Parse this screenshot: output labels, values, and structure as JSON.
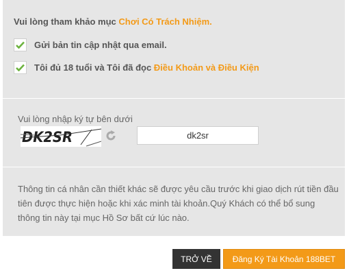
{
  "consent": {
    "intro_prefix": "Vui lòng tham khảo mục ",
    "intro_link": "Chơi Có Trách Nhiệm.",
    "newsletter_label": "Gửi bản tin cập nhật qua email.",
    "age_label_prefix": "Tôi đủ 18 tuổi và Tôi đã đọc ",
    "age_label_link": "Điều Khoản và Điều Kiện",
    "newsletter_checked": true,
    "age_checked": true
  },
  "captcha": {
    "label": "Vui lòng nhập ký tự bên dưới",
    "image_text": "DK2SR",
    "input_value": "dk2sr",
    "refresh_icon": "refresh-icon"
  },
  "info": {
    "text": "Thông tin cá nhân cần thiết khác sẽ được yêu cầu trước khi giao dịch rút tiền đầu tiên được thực hiện hoặc khi xác minh tài khoản.Quý Khách có thể bổ sung thông tin này tại mục Hồ Sơ bất cứ lúc nào."
  },
  "buttons": {
    "back": "TRỞ VỀ",
    "register": "Đăng Ký Tài Khoản 188BET"
  },
  "colors": {
    "accent": "#f39a18",
    "check": "#6db33f",
    "panel": "#e6e6e6",
    "back_button": "#333333"
  }
}
